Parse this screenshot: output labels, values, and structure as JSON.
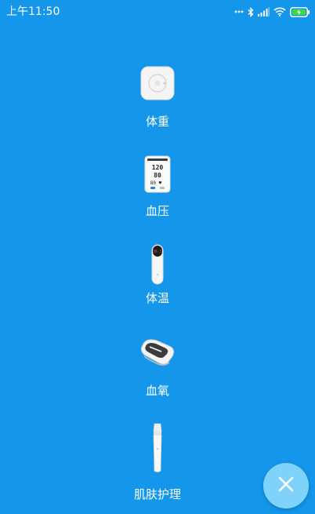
{
  "status_bar": {
    "time": "上午11:50"
  },
  "devices": [
    {
      "label": "体重",
      "icon": "weight-scale-icon"
    },
    {
      "label": "血压",
      "icon": "blood-pressure-monitor-icon"
    },
    {
      "label": "体温",
      "icon": "thermometer-icon"
    },
    {
      "label": "血氧",
      "icon": "pulse-oximeter-icon"
    },
    {
      "label": "肌肤护理",
      "icon": "skin-care-brush-icon"
    }
  ],
  "close_button": {
    "icon": "close-icon"
  },
  "colors": {
    "background": "#1496ea",
    "fab": "#7fd3fa",
    "text": "#ffffff"
  }
}
